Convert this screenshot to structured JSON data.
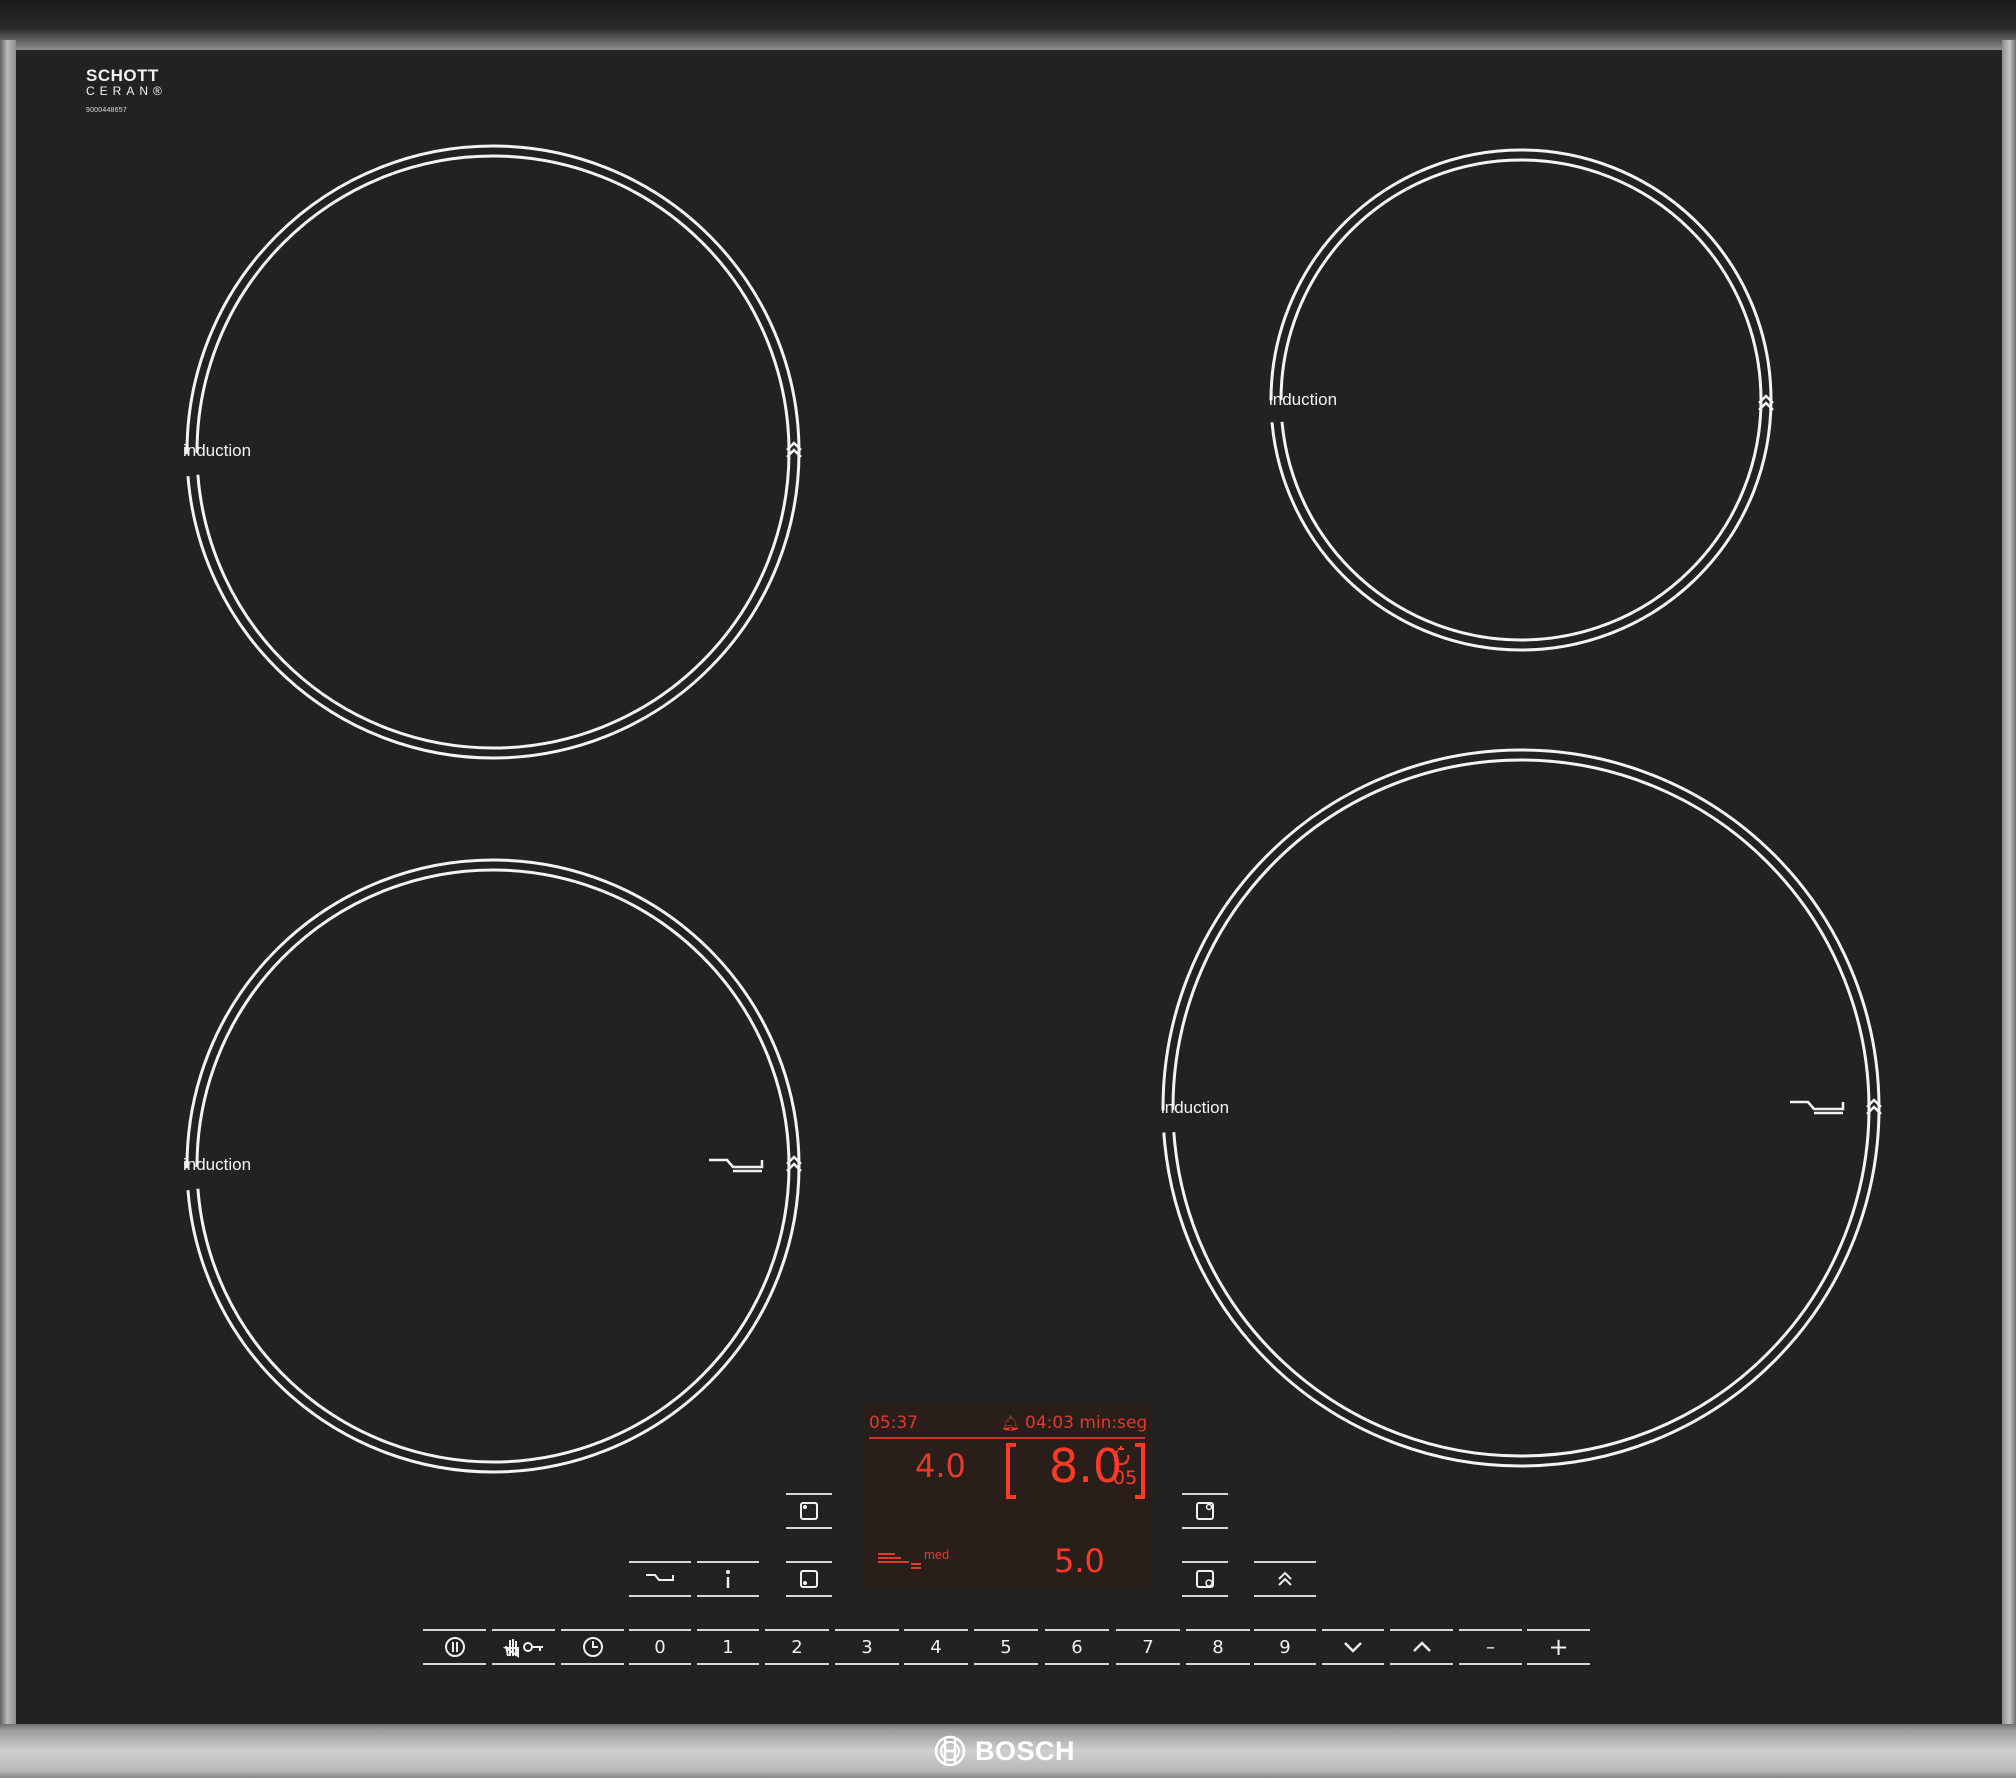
{
  "appliance": {
    "glass_brand_line1": "SCHOTT",
    "glass_brand_line2": "CERAN®",
    "serial": "9000448657",
    "brand": "BOSCH",
    "colors": {
      "glass": "#222220",
      "display_red": "#ff3a26",
      "marking": "#f3f3f3"
    }
  },
  "zones": [
    {
      "id": "front-left-top",
      "label": "induction",
      "icons": [
        "powerboost-icon"
      ]
    },
    {
      "id": "back-right",
      "label": "induction",
      "icons": [
        "powerboost-icon"
      ]
    },
    {
      "id": "front-left",
      "label": "induction",
      "icons": [
        "frying-sensor-icon",
        "powerboost-icon"
      ]
    },
    {
      "id": "front-right",
      "label": "induction",
      "icons": [
        "frying-sensor-icon",
        "powerboost-icon"
      ]
    }
  ],
  "display": {
    "clock": "05:37",
    "timer_icon": "bell-icon",
    "timer": "04:03 min:seg",
    "left_zone_level": "4.0",
    "selected_zone_level": "8.0",
    "selected_zone_timer": "05",
    "frying_level": "med",
    "right_zone_level": "5.0"
  },
  "controls": {
    "zone_select_icons": [
      "zone-back-left-icon",
      "zone-front-left-icon",
      "zone-back-right-icon",
      "zone-front-right-icon"
    ],
    "function_keys": [
      {
        "name": "frying-sensor-key",
        "icon": "frying-pan-icon"
      },
      {
        "name": "info-key",
        "icon": "info-icon"
      },
      {
        "name": "powerboost-key",
        "icon": "powerboost-icon"
      }
    ],
    "bottom_row": [
      {
        "name": "power-key",
        "icon": "power-icon"
      },
      {
        "name": "childlock-key",
        "icon": "hand-key-icon"
      },
      {
        "name": "timer-key",
        "icon": "clock-icon"
      },
      {
        "name": "digit-0",
        "label": "0"
      },
      {
        "name": "digit-1",
        "label": "1"
      },
      {
        "name": "digit-2",
        "label": "2"
      },
      {
        "name": "digit-3",
        "label": "3"
      },
      {
        "name": "digit-4",
        "label": "4"
      },
      {
        "name": "digit-5",
        "label": "5"
      },
      {
        "name": "digit-6",
        "label": "6"
      },
      {
        "name": "digit-7",
        "label": "7"
      },
      {
        "name": "digit-8",
        "label": "8"
      },
      {
        "name": "digit-9",
        "label": "9"
      },
      {
        "name": "down-key",
        "icon": "chevron-down-icon"
      },
      {
        "name": "up-key",
        "icon": "chevron-up-icon"
      },
      {
        "name": "minus-key",
        "label": "–"
      },
      {
        "name": "plus-key",
        "label": "+"
      }
    ]
  }
}
